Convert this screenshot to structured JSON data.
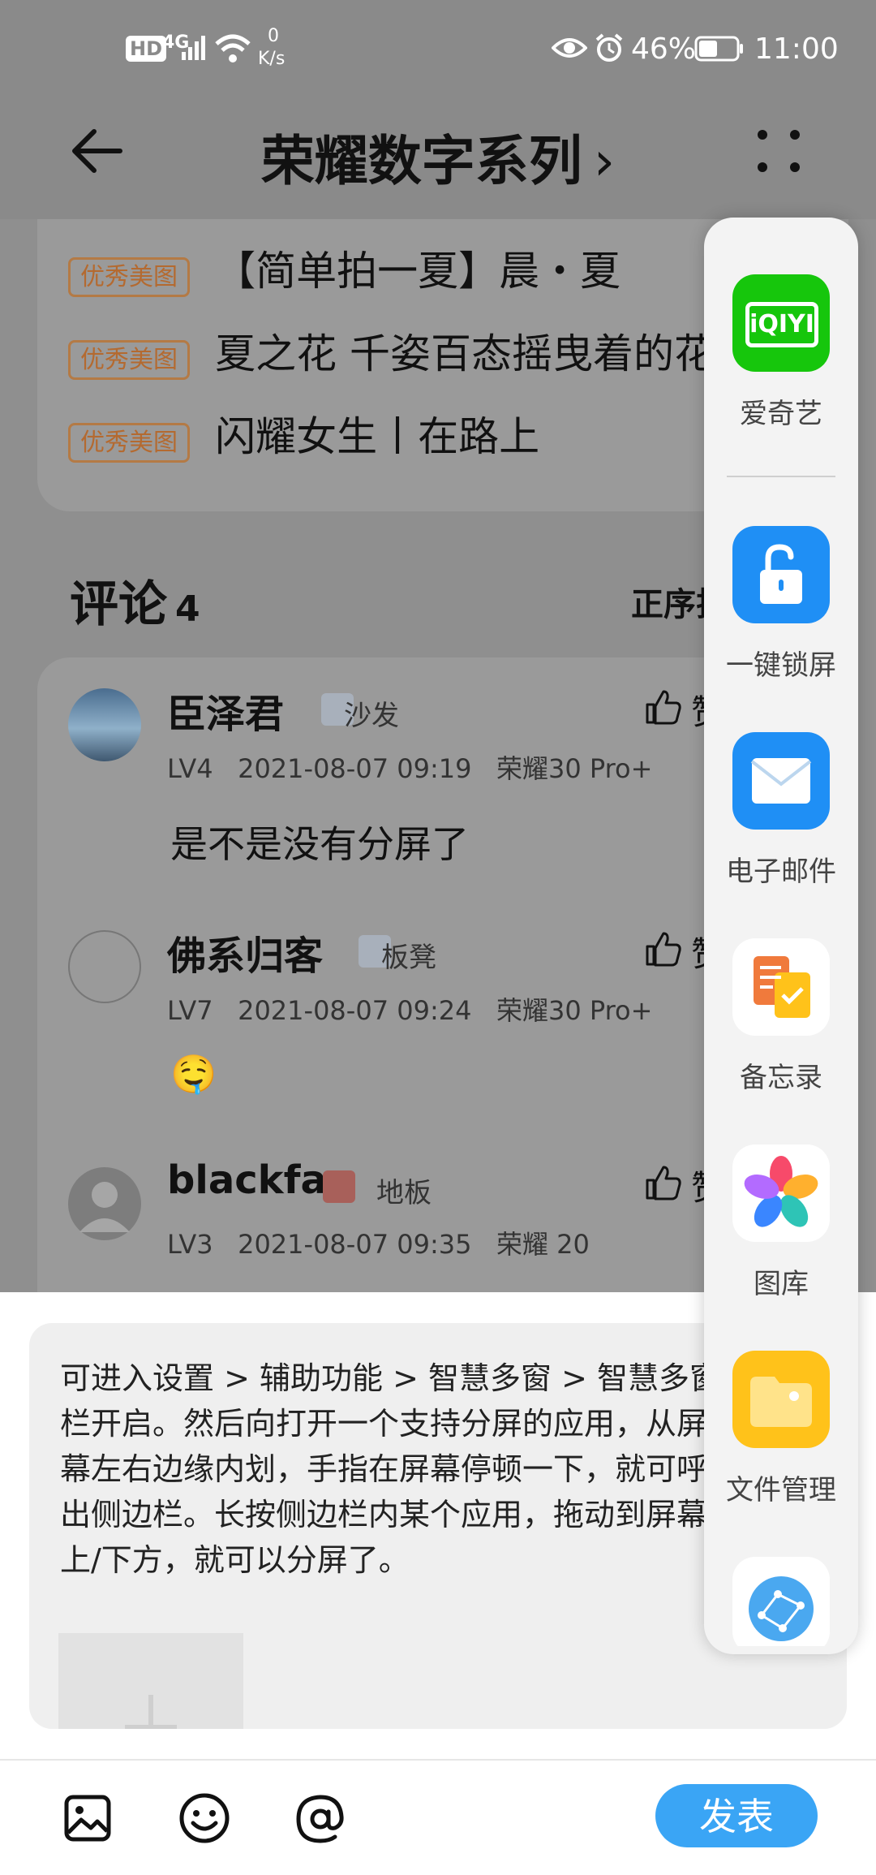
{
  "status_bar": {
    "network": "HD",
    "signal": "4G",
    "speed_value": "0",
    "speed_unit": "K/s",
    "battery": "46%",
    "time": "11:00"
  },
  "header": {
    "title": "荣耀数字系列",
    "chevron": "›"
  },
  "recommendations": [
    {
      "badge": "优秀美图",
      "title": "【简单拍一夏】晨・夏"
    },
    {
      "badge": "优秀美图",
      "title": "夏之花 千姿百态摇曳着的花"
    },
    {
      "badge": "优秀美图",
      "title": "闪耀女生丨在路上"
    }
  ],
  "comments_section": {
    "title": "评论",
    "count": "4",
    "sort_label": "正序排"
  },
  "comments": [
    {
      "name": "臣泽君",
      "floor": "沙发",
      "level": "LV4",
      "time": "2021-08-07 09:19",
      "device": "荣耀30 Pro+",
      "text": "是不是没有分屏了",
      "like": "赞"
    },
    {
      "name": "佛系归客",
      "floor": "板凳",
      "level": "LV7",
      "time": "2021-08-07 09:24",
      "device": "荣耀30 Pro+",
      "text": "🤤",
      "like": "赞"
    },
    {
      "name": "blackfan",
      "floor": "地板",
      "level": "LV3",
      "time": "2021-08-07 09:35",
      "device": "荣耀 20",
      "text": "",
      "like": "赞"
    }
  ],
  "reply": {
    "text": "可进入设置 > 辅助功能 > 智慧多窗 > 智慧多窗\n栏开启。然后向打开一个支持分屏的应用，从屏\n幕左右边缘内划，手指在屏幕停顿一下，就可呼\n出侧边栏。长按侧边栏内某个应用，拖动到屏幕\n上/下方，就可以分屏了。"
  },
  "toolbar": {
    "publish_label": "发表"
  },
  "dock": {
    "apps": [
      {
        "label": "爱奇艺",
        "icon": "iqiyi-icon",
        "color": "#16c60c",
        "icon_text": "iQIYI"
      },
      {
        "label": "一键锁屏",
        "icon": "lock-icon",
        "color": "#1f8ff5"
      },
      {
        "label": "电子邮件",
        "icon": "mail-icon",
        "color": "#1f8ff5"
      },
      {
        "label": "备忘录",
        "icon": "notes-icon",
        "color": "#ffffff"
      },
      {
        "label": "图库",
        "icon": "gallery-icon",
        "color": "#ffffff"
      },
      {
        "label": "文件管理",
        "icon": "files-icon",
        "color": "#ffc21a"
      },
      {
        "label": "",
        "icon": "browser-icon",
        "color": "#ffffff"
      }
    ]
  }
}
